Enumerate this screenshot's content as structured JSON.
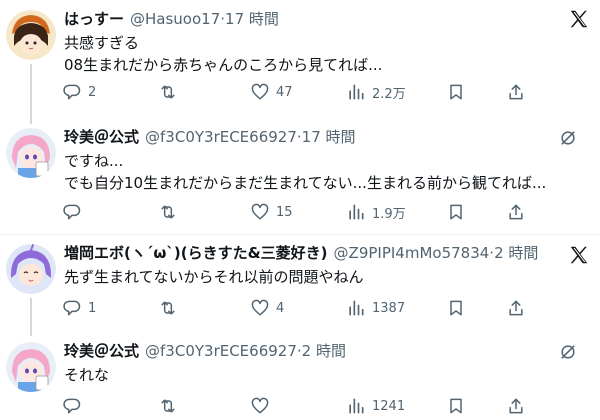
{
  "tweets": [
    {
      "name": "はっすー",
      "handle": "@Hasuoo17",
      "dot": "·",
      "time": "17 時間",
      "lines": [
        "共感すぎる",
        "08生まれだから赤ちゃんのころから見てれば..."
      ],
      "replies": "2",
      "retweets": "",
      "likes": "47",
      "views": "2.2万"
    },
    {
      "name": "玲美＠公式",
      "handle": "@f3C0Y3rECE66927",
      "dot": "·",
      "time": "17 時間",
      "lines": [
        "ですね...",
        "でも自分10生まれだからまだ生まれてない...生まれる前から観てれば..."
      ],
      "replies": "",
      "retweets": "",
      "likes": "15",
      "views": "1.9万"
    },
    {
      "name": "増岡エボ(ヽ´ω`)(らきすた&三菱好き)",
      "handle": "@Z9PIPI4mMo57834",
      "dot": "·",
      "time": "2 時間",
      "lines": [
        "先ず生まれてないからそれ以前の問題やねん"
      ],
      "replies": "1",
      "retweets": "",
      "likes": "4",
      "views": "1387"
    },
    {
      "name": "玲美＠公式",
      "handle": "@f3C0Y3rECE66927",
      "dot": "·",
      "time": "2 時間",
      "lines": [
        "それな"
      ],
      "replies": "",
      "retweets": "",
      "likes": "",
      "views": "1241"
    }
  ],
  "icons": {
    "reply": "reply-icon",
    "retweet": "retweet-icon",
    "like": "heart-icon",
    "views": "views-icon",
    "bookmark": "bookmark-icon",
    "share": "share-icon",
    "x_logo": "x-logo-icon",
    "grok": "grok-icon"
  },
  "colors": {
    "text": "#0f1419",
    "muted": "#536471",
    "thread_line": "#cfd9de",
    "divider": "#eff3f4"
  }
}
